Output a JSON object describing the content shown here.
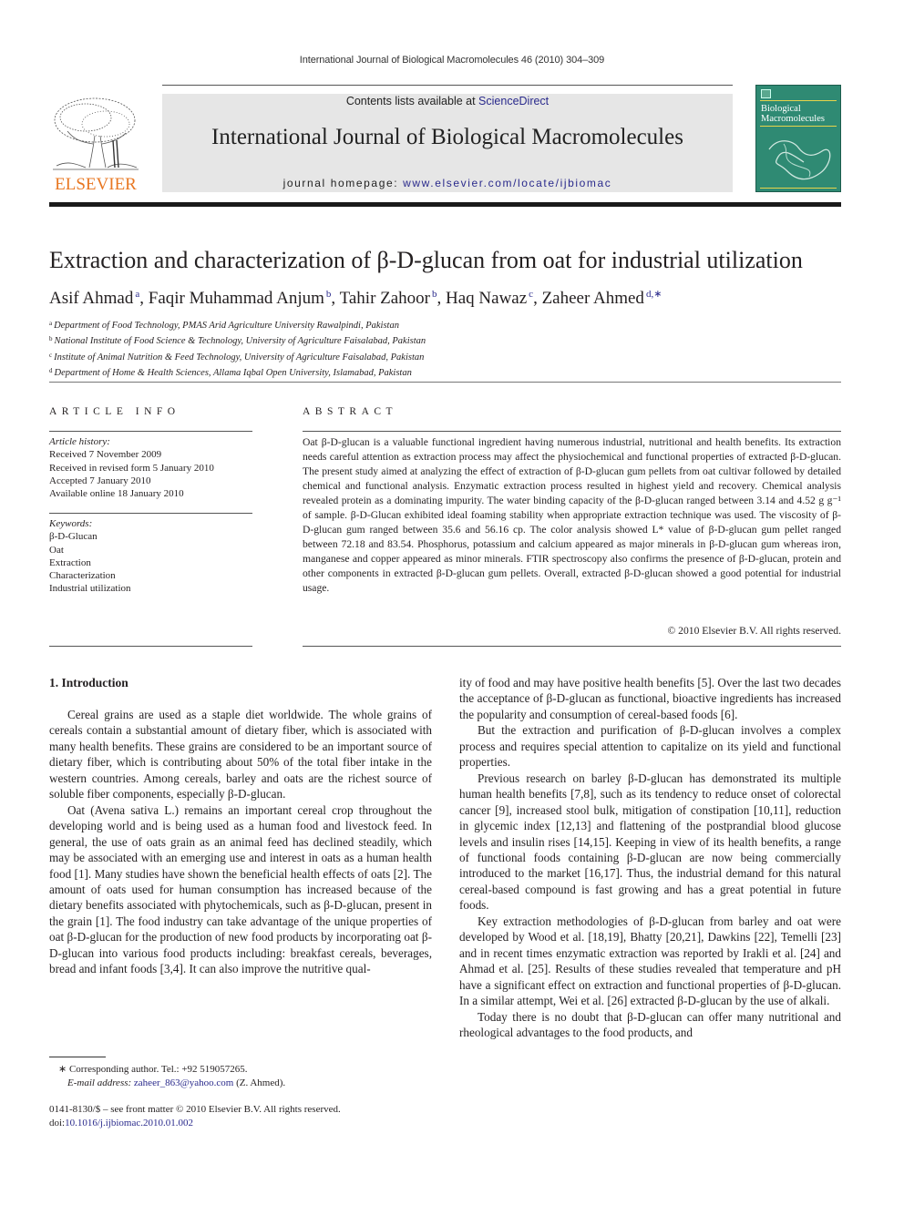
{
  "running_head": "International Journal of Biological Macromolecules 46 (2010) 304–309",
  "header": {
    "publisher_logo_text": "ELSEVIER",
    "contents_prefix": "Contents lists available at ",
    "contents_link": "ScienceDirect",
    "journal_title": "International Journal of Biological Macromolecules",
    "homepage_prefix": "journal homepage: ",
    "homepage_link": "www.elsevier.com/locate/ijbiomac",
    "cover_title_line1": "Biological",
    "cover_title_line2": "Macromolecules",
    "colors": {
      "elsevier_orange": "#e87722",
      "banner_gray": "#e6e6e6",
      "cover_green": "#2f8a73",
      "link_blue": "#2a2a8c"
    }
  },
  "article": {
    "title": "Extraction and characterization of β-D-glucan from oat for industrial utilization",
    "authors": [
      {
        "name": "Asif Ahmad",
        "sup": "a"
      },
      {
        "name": "Faqir Muhammad Anjum",
        "sup": "b"
      },
      {
        "name": "Tahir Zahoor",
        "sup": "b"
      },
      {
        "name": "Haq Nawaz",
        "sup": "c"
      },
      {
        "name": "Zaheer Ahmed",
        "sup": "d,∗"
      }
    ],
    "affiliations": [
      {
        "sup": "a",
        "text": "Department of Food Technology, PMAS Arid Agriculture University Rawalpindi, Pakistan"
      },
      {
        "sup": "b",
        "text": "National Institute of Food Science & Technology, University of Agriculture Faisalabad, Pakistan"
      },
      {
        "sup": "c",
        "text": "Institute of Animal Nutrition & Feed Technology, University of Agriculture Faisalabad, Pakistan"
      },
      {
        "sup": "d",
        "text": "Department of Home & Health Sciences, Allama Iqbal Open University, Islamabad, Pakistan"
      }
    ]
  },
  "article_info": {
    "heading": "ARTICLE INFO",
    "history_label": "Article history:",
    "history": [
      "Received 7 November 2009",
      "Received in revised form 5 January 2010",
      "Accepted 7 January 2010",
      "Available online 18 January 2010"
    ],
    "keywords_label": "Keywords:",
    "keywords": [
      "β-D-Glucan",
      "Oat",
      "Extraction",
      "Characterization",
      "Industrial utilization"
    ]
  },
  "abstract": {
    "heading": "ABSTRACT",
    "text": "Oat β-D-glucan is a valuable functional ingredient having numerous industrial, nutritional and health benefits. Its extraction needs careful attention as extraction process may affect the physiochemical and functional properties of extracted β-D-glucan. The present study aimed at analyzing the effect of extraction of β-D-glucan gum pellets from oat cultivar followed by detailed chemical and functional analysis. Enzymatic extraction process resulted in highest yield and recovery. Chemical analysis revealed protein as a dominating impurity. The water binding capacity of the β-D-glucan ranged between 3.14 and 4.52 g g⁻¹ of sample. β-D-Glucan exhibited ideal foaming stability when appropriate extraction technique was used. The viscosity of β-D-glucan gum ranged between 35.6 and 56.16 cp. The color analysis showed L* value of β-D-glucan gum pellet ranged between 72.18 and 83.54. Phosphorus, potassium and calcium appeared as major minerals in β-D-glucan gum whereas iron, manganese and copper appeared as minor minerals. FTIR spectroscopy also confirms the presence of β-D-glucan, protein and other components in extracted β-D-glucan gum pellets. Overall, extracted β-D-glucan showed a good potential for industrial usage.",
    "copyright": "© 2010 Elsevier B.V. All rights reserved."
  },
  "intro": {
    "heading": "1.  Introduction",
    "left_paragraphs": [
      "Cereal grains are used as a staple diet worldwide. The whole grains of cereals contain a substantial amount of dietary fiber, which is associated with many health benefits. These grains are considered to be an important source of dietary fiber, which is contributing about 50% of the total fiber intake in the western countries. Among cereals, barley and oats are the richest source of soluble fiber components, especially β-D-glucan.",
      "Oat (Avena sativa L.) remains an important cereal crop throughout the developing world and is being used as a human food and livestock feed. In general, the use of oats grain as an animal feed has declined steadily, which may be associated with an emerging use and interest in oats as a human health food [1]. Many studies have shown the beneficial health effects of oats [2]. The amount of oats used for human consumption has increased because of the dietary benefits associated with phytochemicals, such as β-D-glucan, present in the grain [1]. The food industry can take advantage of the unique properties of oat β-D-glucan for the production of new food products by incorporating oat β-D-glucan into various food products including: breakfast cereals, beverages, bread and infant foods [3,4]. It can also improve the nutritive qual-"
    ],
    "right_paragraphs": [
      "ity of food and may have positive health benefits [5]. Over the last two decades the acceptance of β-D-glucan as functional, bioactive ingredients has increased the popularity and consumption of cereal-based foods [6].",
      "But the extraction and purification of β-D-glucan involves a complex process and requires special attention to capitalize on its yield and functional properties.",
      "Previous research on barley β-D-glucan has demonstrated its multiple human health benefits [7,8], such as its tendency to reduce onset of colorectal cancer [9], increased stool bulk, mitigation of constipation [10,11], reduction in glycemic index [12,13] and flattening of the postprandial blood glucose levels and insulin rises [14,15]. Keeping in view of its health benefits, a range of functional foods containing β-D-glucan are now being commercially introduced to the market [16,17]. Thus, the industrial demand for this natural cereal-based compound is fast growing and has a great potential in future foods.",
      "Key extraction methodologies of β-D-glucan from barley and oat were developed by Wood et al. [18,19], Bhatty [20,21], Dawkins [22], Temelli [23] and in recent times enzymatic extraction was reported by Irakli et al. [24] and Ahmad et al. [25]. Results of these studies revealed that temperature and pH have a significant effect on extraction and functional properties of β-D-glucan. In a similar attempt, Wei et al. [26] extracted β-D-glucan by the use of alkali.",
      "Today there is no doubt that β-D-glucan can offer many nutritional and rheological advantages to the food products, and"
    ]
  },
  "footnotes": {
    "corresponding": "∗ Corresponding author. Tel.: +92 519057265.",
    "email_label": "E-mail address: ",
    "email": "zaheer_863@yahoo.com",
    "email_suffix": " (Z. Ahmed).",
    "front_matter": "0141-8130/$ – see front matter © 2010 Elsevier B.V. All rights reserved.",
    "doi_label": "doi:",
    "doi": "10.1016/j.ijbiomac.2010.01.002"
  }
}
